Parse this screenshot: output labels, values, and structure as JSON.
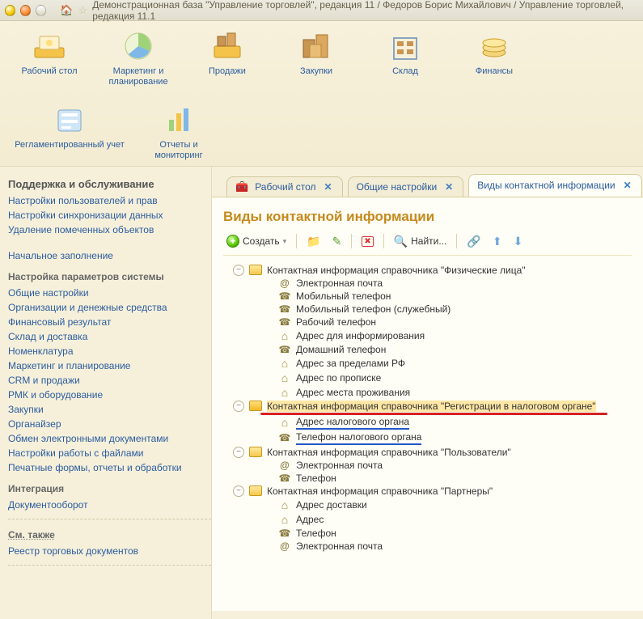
{
  "titlebar": {
    "home_icon": "🏠",
    "star_icon": "☆",
    "title": "Демонстрационная база \"Управление торговлей\", редакция 11 / Федоров Борис Михайлович / Управление торговлей, редакция 11.1"
  },
  "topbar": [
    {
      "id": "desktop",
      "label": "Рабочий стол"
    },
    {
      "id": "marketing",
      "label": "Маркетинг и планирование"
    },
    {
      "id": "sales",
      "label": "Продажи"
    },
    {
      "id": "purchases",
      "label": "Закупки"
    },
    {
      "id": "warehouse",
      "label": "Склад"
    },
    {
      "id": "finance",
      "label": "Финансы"
    },
    {
      "id": "regulated",
      "label": "Регламентированный учет"
    },
    {
      "id": "reports",
      "label": "Отчеты и мониторинг"
    }
  ],
  "sidebar": {
    "heading_main": "Поддержка и обслуживание",
    "links1": [
      "Настройки пользователей и прав",
      "Настройки синхронизации данных",
      "Удаление помеченных объектов"
    ],
    "link_single": "Начальное заполнение",
    "heading_params": "Настройка параметров системы",
    "links_params": [
      "Общие настройки",
      "Организации и денежные средства",
      "Финансовый результат",
      "Склад и доставка",
      "Номенклатура",
      "Маркетинг и планирование",
      "CRM и продажи",
      "РМК и оборудование",
      "Закупки",
      "Органайзер",
      "Обмен электронными документами",
      "Настройки работы с файлами",
      "Печатные формы, отчеты и обработки"
    ],
    "heading_integration": "Интеграция",
    "links_integration": [
      "Документооборот"
    ],
    "heading_seealso": "См. также",
    "links_seealso": [
      "Реестр торговых документов"
    ]
  },
  "tabs": [
    {
      "icon": "🧰",
      "label": "Рабочий стол",
      "active": false
    },
    {
      "icon": "",
      "label": "Общие настройки",
      "active": false
    },
    {
      "icon": "",
      "label": "Виды контактной информации",
      "active": true
    }
  ],
  "page_title": "Виды контактной информации",
  "toolbar": {
    "create": "Создать",
    "find": "Найти..."
  },
  "tree": {
    "g1": {
      "label": "Контактная информация справочника \"Физические лица\"",
      "items": [
        {
          "icon": "email",
          "label": "Электронная почта"
        },
        {
          "icon": "phone",
          "label": "Мобильный телефон"
        },
        {
          "icon": "phone",
          "label": "Мобильный телефон (служебный)"
        },
        {
          "icon": "phone",
          "label": "Рабочий телефон"
        },
        {
          "icon": "house",
          "label": "Адрес для информирования"
        },
        {
          "icon": "phone",
          "label": "Домашний телефон"
        },
        {
          "icon": "house",
          "label": "Адрес за пределами РФ"
        },
        {
          "icon": "house",
          "label": "Адрес по прописке"
        },
        {
          "icon": "house",
          "label": "Адрес места проживания"
        }
      ]
    },
    "g2": {
      "label": "Контактная информация справочника \"Регистрации в налоговом органе\"",
      "items": [
        {
          "icon": "house",
          "label": "Адрес налогового органа"
        },
        {
          "icon": "phone",
          "label": "Телефон налогового органа"
        }
      ]
    },
    "g3": {
      "label": "Контактная информация справочника \"Пользователи\"",
      "items": [
        {
          "icon": "email",
          "label": "Электронная почта"
        },
        {
          "icon": "phone",
          "label": "Телефон"
        }
      ]
    },
    "g4": {
      "label": "Контактная информация справочника \"Партнеры\"",
      "items": [
        {
          "icon": "house",
          "label": "Адрес доставки"
        },
        {
          "icon": "house",
          "label": "Адрес"
        },
        {
          "icon": "phone",
          "label": "Телефон"
        },
        {
          "icon": "email",
          "label": "Электронная почта"
        }
      ]
    }
  }
}
